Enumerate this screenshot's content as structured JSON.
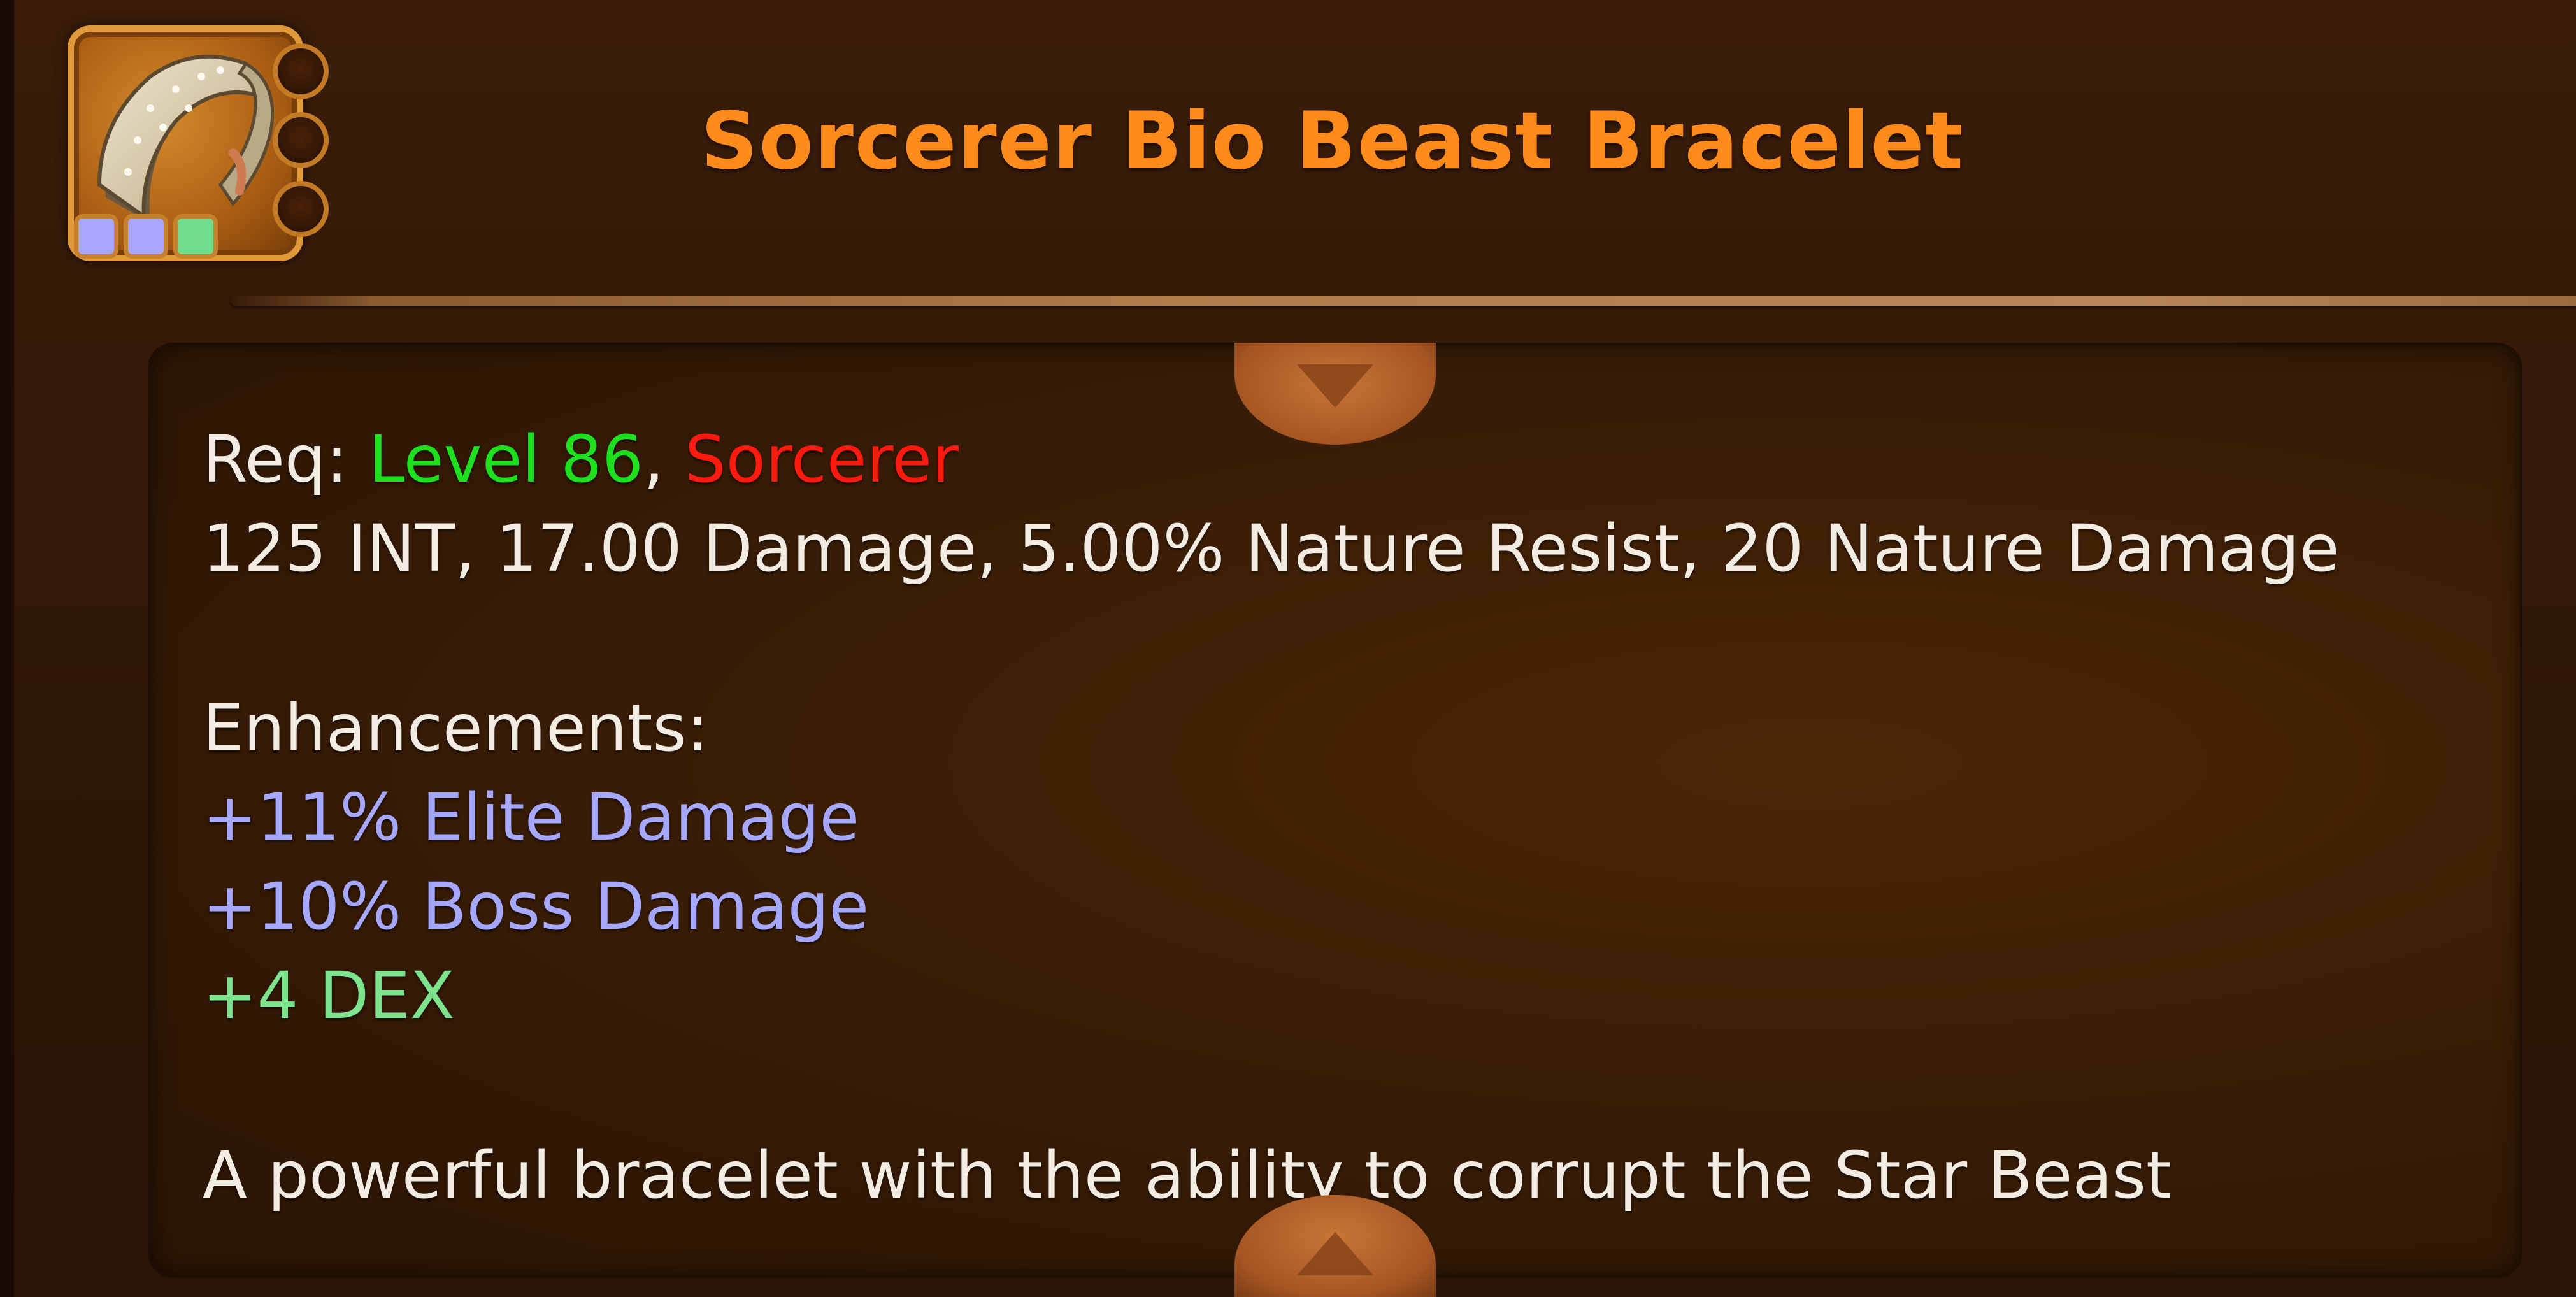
{
  "item": {
    "title": "Sorcerer Bio Beast Bracelet",
    "icon_name": "bracelet-icon",
    "socket_count": 3,
    "gems": [
      {
        "color": "#a9a6ff"
      },
      {
        "color": "#a9a6ff"
      },
      {
        "color": "#6fdd8b"
      }
    ]
  },
  "requirements": {
    "prefix": "Req: ",
    "level": "Level 86",
    "separator": ", ",
    "class": "Sorcerer"
  },
  "stats_line": "125 INT, 17.00 Damage, 5.00% Nature Resist, 20 Nature Damage",
  "enhancements": {
    "label": "Enhancements:",
    "items": [
      "+11% Elite Damage",
      "+10% Boss Damage",
      "+4 DEX"
    ]
  },
  "description": "A powerful bracelet with the ability to corrupt the Star Beast",
  "colors": {
    "title": "#ff8c1a",
    "level": "#1fe01f",
    "class": "#ff1a10",
    "enhancement_blue": "#a6a8ff",
    "enhancement_green": "#7ee38d",
    "text": "#f3ece2"
  }
}
